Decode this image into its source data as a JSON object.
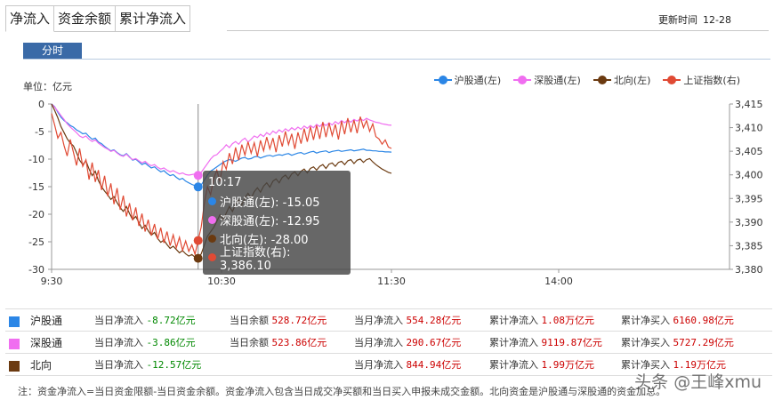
{
  "tabs": [
    "净流入",
    "资金余额",
    "累计净流入"
  ],
  "update": {
    "label": "更新时间",
    "value": "12-28"
  },
  "time_tab": "分时",
  "unit_label": "单位：亿元",
  "legend": [
    {
      "label": "沪股通(左)",
      "color": "#2b86e6"
    },
    {
      "label": "深股通(左)",
      "color": "#f06ef0"
    },
    {
      "label": "北向(左)",
      "color": "#6b3a10"
    },
    {
      "label": "上证指数(右)",
      "color": "#e04a34"
    }
  ],
  "chart_data": {
    "type": "line",
    "x_ticks": [
      "9:30",
      "10:30",
      "11:30",
      "14:00"
    ],
    "y_left": {
      "ticks": [
        "0",
        "-5",
        "-10",
        "-15",
        "-20",
        "-25",
        "-30"
      ],
      "range": [
        -30,
        0
      ]
    },
    "y_right": {
      "ticks": [
        "3,415",
        "3,410",
        "3,405",
        "3,400",
        "3,395",
        "3,390",
        "3,385",
        "3,380"
      ],
      "range": [
        3380,
        3415
      ]
    },
    "cursor_index": 47,
    "series": [
      {
        "name": "沪股通(左)",
        "axis": "left",
        "color": "#2b86e6",
        "values": [
          0,
          -0.5,
          -1.5,
          -2.4,
          -3,
          -3.4,
          -3.9,
          -4.2,
          -4.7,
          -5,
          -5.4,
          -5.3,
          -5.9,
          -6.4,
          -6.2,
          -6.9,
          -7.2,
          -7.7,
          -8.1,
          -8.5,
          -8.3,
          -8.8,
          -9.2,
          -9.4,
          -9,
          -9.6,
          -10.2,
          -10,
          -10.5,
          -11,
          -10.7,
          -11.2,
          -11.6,
          -11.4,
          -11.9,
          -12.3,
          -12.1,
          -12.6,
          -13,
          -12.8,
          -13.3,
          -13.7,
          -13.5,
          -14,
          -14.3,
          -14.6,
          -14.8,
          -15.05,
          -14.7,
          -13.8,
          -12.9,
          -12.2,
          -11.8,
          -11.4,
          -11,
          -10.6,
          -10.3,
          -10.1,
          -10.2,
          -10.4,
          -10.1,
          -9.8,
          -9.7,
          -10,
          -9.9,
          -9.6,
          -9.5,
          -9.8,
          -9.6,
          -9.4,
          -9.3,
          -9.5,
          -9.3,
          -9.2,
          -9.3,
          -9.1,
          -9,
          -9.3,
          -9.1,
          -8.9,
          -8.8,
          -9.1,
          -8.9,
          -8.7,
          -8.6,
          -8.9,
          -8.7,
          -8.6,
          -8.5,
          -8.8,
          -8.6,
          -8.5,
          -8.4,
          -8.6,
          -8.5,
          -8.4,
          -8.3,
          -8.5,
          -8.4,
          -8.3,
          -8.2,
          -8.4,
          -8.4,
          -8.5,
          -8.5,
          -8.6,
          -8.6,
          -8.7,
          -8.7,
          -8.72
        ]
      },
      {
        "name": "深股通(左)",
        "axis": "left",
        "color": "#f06ef0",
        "values": [
          0,
          -0.6,
          -1.3,
          -2.1,
          -2.8,
          -3.6,
          -4.2,
          -4.7,
          -5.2,
          -5.8,
          -6.1,
          -5.8,
          -6.4,
          -6.8,
          -6.5,
          -7.1,
          -7.5,
          -7.9,
          -8.2,
          -8.6,
          -8.4,
          -8.9,
          -9.3,
          -9.5,
          -9.1,
          -9.7,
          -10.1,
          -9.9,
          -10.3,
          -10.7,
          -10.4,
          -10.9,
          -11.2,
          -11,
          -11.5,
          -11.8,
          -11.6,
          -12,
          -12.3,
          -12.1,
          -12.4,
          -12.7,
          -12.5,
          -12.8,
          -12.9,
          -12.8,
          -12.7,
          -12.95,
          -12.4,
          -11.6,
          -10.8,
          -10,
          -9.4,
          -9.2,
          -8.6,
          -8.1,
          -7.4,
          -7.9,
          -7.2,
          -6.8,
          -7.3,
          -6.6,
          -6.2,
          -6.9,
          -6.4,
          -5.8,
          -6.1,
          -5.5,
          -5.9,
          -5.2,
          -5.6,
          -4.9,
          -5.3,
          -4.7,
          -5.1,
          -4.5,
          -4.9,
          -4.3,
          -4.7,
          -4.2,
          -4.6,
          -4,
          -4.4,
          -3.9,
          -4.3,
          -3.7,
          -4.1,
          -3.5,
          -3.9,
          -3.4,
          -3.8,
          -3.2,
          -3.6,
          -3,
          -3.4,
          -2.9,
          -3.3,
          -2.8,
          -3.1,
          -2.7,
          -3,
          -2.6,
          -2.9,
          -3.1,
          -3.3,
          -3.4,
          -3.6,
          -3.7,
          -3.8,
          -3.86
        ]
      },
      {
        "name": "北向(左)",
        "axis": "left",
        "color": "#6b3a10",
        "values": [
          0,
          -1.2,
          -2.5,
          -4.1,
          -5.2,
          -6.3,
          -7.1,
          -7.6,
          -8.8,
          -10.2,
          -11,
          -10.3,
          -11.8,
          -13,
          -12.2,
          -13.9,
          -15,
          -15.8,
          -16.5,
          -17.3,
          -16.8,
          -17.9,
          -18.8,
          -19.5,
          -18.6,
          -19.9,
          -21,
          -20.4,
          -21.5,
          -22.6,
          -22,
          -23,
          -23.8,
          -23.3,
          -24.4,
          -25.1,
          -24.7,
          -25.5,
          -26.2,
          -25.8,
          -26.4,
          -27,
          -26.6,
          -27.2,
          -27.6,
          -27.3,
          -27.8,
          -28,
          -27.2,
          -25.6,
          -24,
          -23.2,
          -22.4,
          -21.3,
          -20.1,
          -21,
          -19.8,
          -18.6,
          -19.5,
          -18.2,
          -17.4,
          -18.3,
          -17,
          -16.2,
          -17.1,
          -15.9,
          -15.2,
          -16,
          -14.9,
          -14.3,
          -15.1,
          -14,
          -13.6,
          -14.3,
          -13.3,
          -12.9,
          -13.6,
          -12.7,
          -12.3,
          -13,
          -12.2,
          -11.8,
          -12.5,
          -11.7,
          -11.4,
          -12,
          -11.3,
          -11,
          -11.7,
          -10.9,
          -10.7,
          -11.3,
          -10.6,
          -10.4,
          -11,
          -10.3,
          -10.1,
          -10.8,
          -10.2,
          -10,
          -10.6,
          -10.1,
          -9.9,
          -10.5,
          -11,
          -11.4,
          -11.8,
          -12.1,
          -12.4,
          -12.57
        ]
      },
      {
        "name": "上证指数(右)",
        "axis": "right",
        "color": "#e04a34",
        "values": [
          3413,
          3410.5,
          3407.8,
          3409,
          3406.2,
          3404,
          3407.5,
          3404.8,
          3402,
          3405.6,
          3401.8,
          3403.2,
          3399,
          3402.6,
          3398.5,
          3401,
          3396.8,
          3399.8,
          3395.5,
          3398.2,
          3393.8,
          3397.2,
          3392.6,
          3395.6,
          3391.2,
          3394,
          3390.4,
          3393.1,
          3389.2,
          3391.8,
          3388,
          3390.5,
          3387.2,
          3389.6,
          3386.4,
          3388.8,
          3385.6,
          3388,
          3385,
          3387.3,
          3384.6,
          3386.8,
          3384,
          3386,
          3383.8,
          3385.2,
          3383.2,
          3386.1,
          3389,
          3394,
          3397.5,
          3395.8,
          3399.2,
          3401,
          3398.6,
          3402.8,
          3401.2,
          3404.6,
          3402.3,
          3405.8,
          3403.1,
          3406.4,
          3404.2,
          3407,
          3404.6,
          3406.8,
          3403.9,
          3407.3,
          3405.1,
          3408,
          3405.5,
          3407.8,
          3404.8,
          3408.4,
          3406,
          3409.2,
          3406.4,
          3408.7,
          3405.5,
          3409,
          3406.6,
          3409.8,
          3407,
          3410.2,
          3407.4,
          3410.5,
          3407.6,
          3411.2,
          3408,
          3411,
          3408.3,
          3410.7,
          3407.5,
          3411.4,
          3408.6,
          3412,
          3409,
          3411.6,
          3408.8,
          3412.3,
          3410,
          3411.5,
          3409.2,
          3410.8,
          3408.1,
          3407.6,
          3406.5,
          3407.4,
          3405.9,
          3405.6
        ]
      }
    ]
  },
  "tooltip": {
    "time": "10:17",
    "rows": [
      {
        "label": "沪股通(左): -15.05",
        "color": "#2b86e6"
      },
      {
        "label": "深股通(左): -12.95",
        "color": "#f06ef0"
      },
      {
        "label": "北向(左): -28.00",
        "color": "#6b3a10"
      },
      {
        "label": "上证指数(右): 3,386.10",
        "color": "#e04a34"
      }
    ]
  },
  "summary": [
    {
      "name": "沪股通",
      "color": "#2b86e6",
      "c1_label": "当日净流入",
      "c1_value": "-8.72亿元",
      "c2_label": "当日余额",
      "c2_value": "528.72亿元",
      "c3_label": "当月净流入",
      "c3_value": "554.28亿元",
      "c4_label": "累计净流入",
      "c4_value": "1.08万亿元",
      "c5_label": "累计净买入",
      "c5_value": "6160.98亿元"
    },
    {
      "name": "深股通",
      "color": "#f06ef0",
      "c1_label": "当日净流入",
      "c1_value": "-3.86亿元",
      "c2_label": "当日余额",
      "c2_value": "523.86亿元",
      "c3_label": "当月净流入",
      "c3_value": "290.67亿元",
      "c4_label": "累计净流入",
      "c4_value": "9119.87亿元",
      "c5_label": "累计净买入",
      "c5_value": "5727.29亿元"
    },
    {
      "name": "北向",
      "color": "#6b3a10",
      "c1_label": "当日净流入",
      "c1_value": "-12.57亿元",
      "c2_label": "",
      "c2_value": "",
      "c3_label": "当月净流入",
      "c3_value": "844.94亿元",
      "c4_label": "累计净流入",
      "c4_value": "1.99万亿元",
      "c5_label": "累计净买入",
      "c5_value": "1.19万亿元"
    }
  ],
  "note": "注：资金净流入=当日资金限额-当日资金余额。资金净流入包含当日成交净买额和当日买入申报未成交金额。北向资金是沪股通与深股通的资金加总。",
  "watermark": "头条 @王峰xmu"
}
